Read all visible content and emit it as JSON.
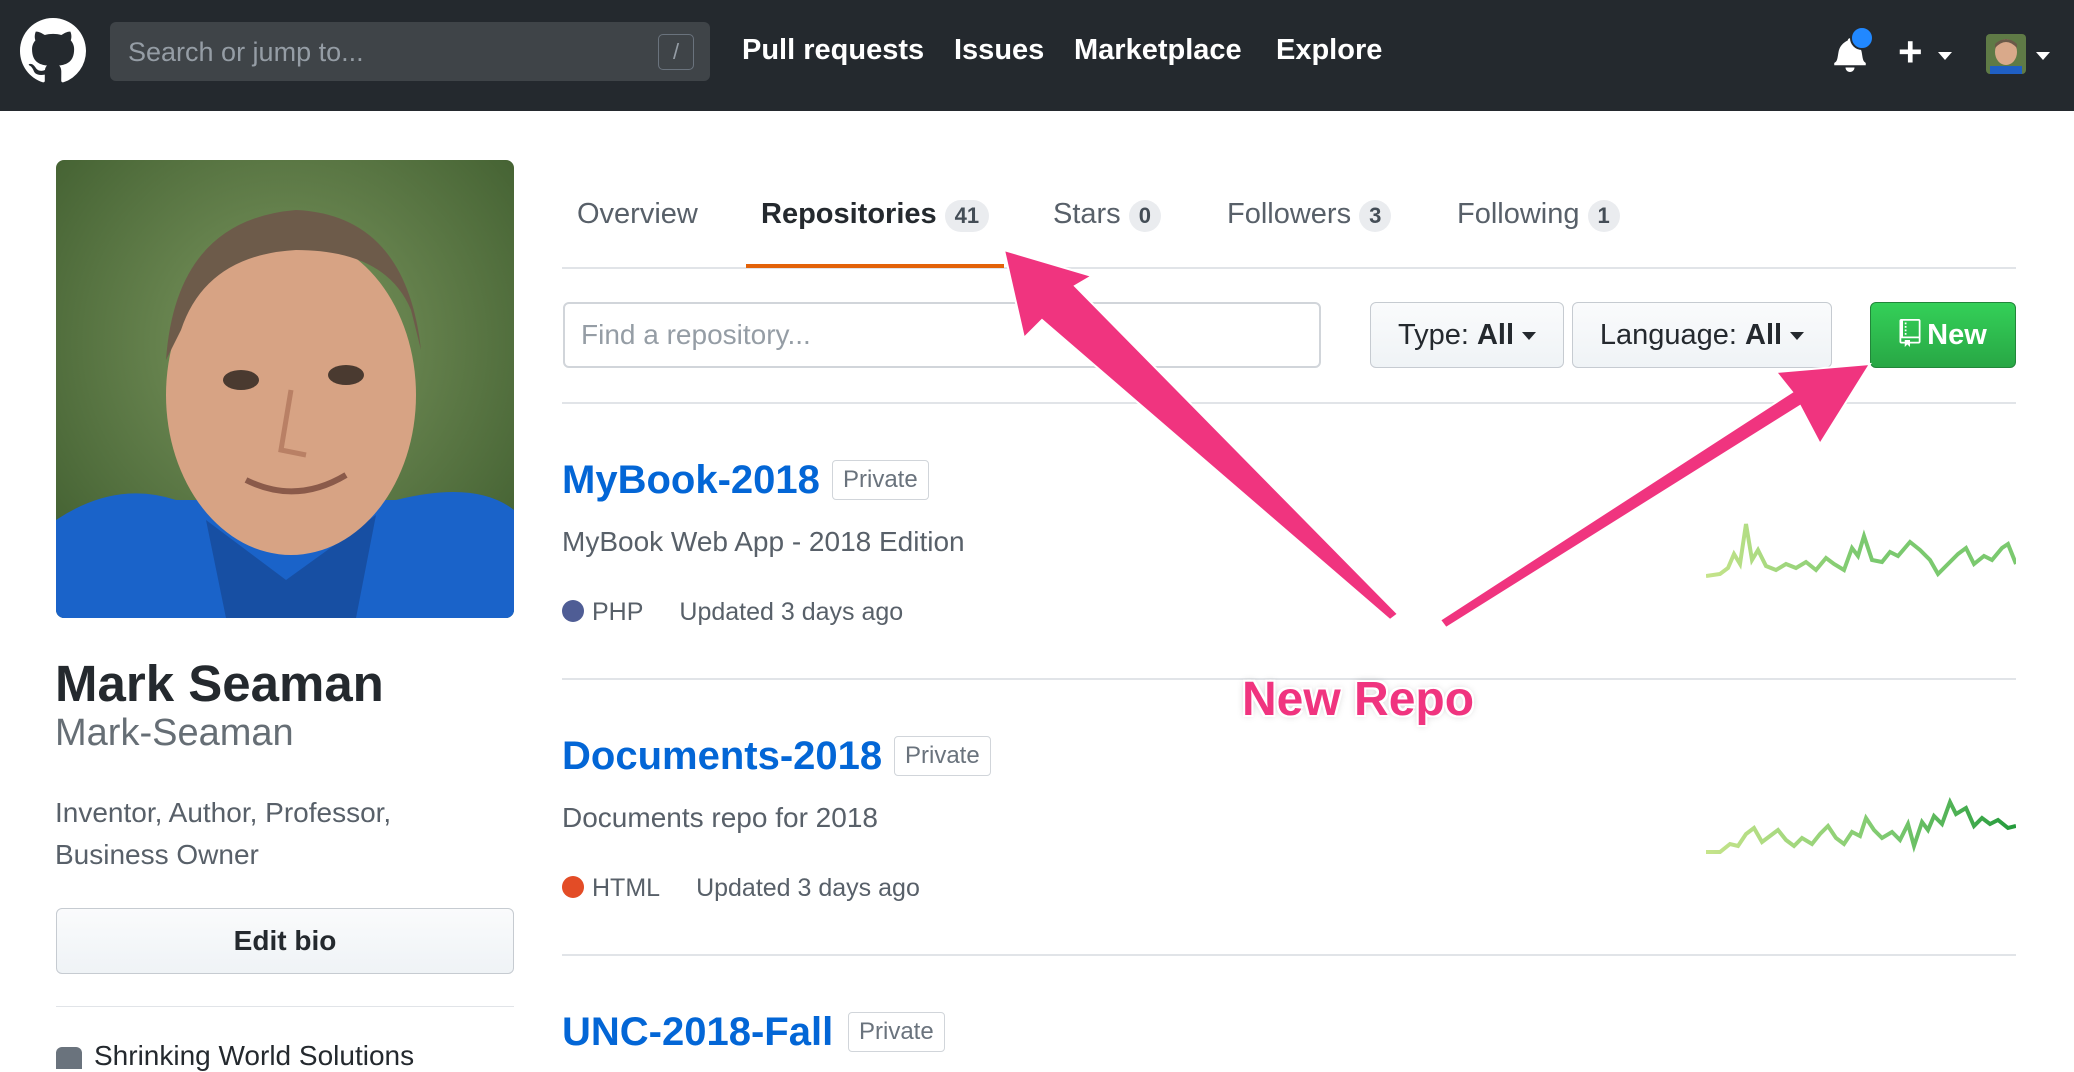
{
  "header": {
    "search_placeholder": "Search or jump to...",
    "search_shortcut": "/",
    "nav": [
      "Pull requests",
      "Issues",
      "Marketplace",
      "Explore"
    ]
  },
  "profile": {
    "name": "Mark Seaman",
    "login": "Mark-Seaman",
    "bio": "Inventor, Author, Professor, Business Owner",
    "edit_bio_label": "Edit bio",
    "org": "Shrinking World Solutions"
  },
  "tabs": [
    {
      "label": "Overview",
      "count": null
    },
    {
      "label": "Repositories",
      "count": "41"
    },
    {
      "label": "Stars",
      "count": "0"
    },
    {
      "label": "Followers",
      "count": "3"
    },
    {
      "label": "Following",
      "count": "1"
    }
  ],
  "filters": {
    "find_placeholder": "Find a repository...",
    "type_label": "Type:",
    "type_value": "All",
    "language_label": "Language:",
    "language_value": "All",
    "new_label": "New"
  },
  "repos": [
    {
      "name": "MyBook-2018",
      "visibility": "Private",
      "description": "MyBook Web App - 2018 Edition",
      "language": "PHP",
      "language_color": "#4F5D95",
      "updated": "Updated 3 days ago"
    },
    {
      "name": "Documents-2018",
      "visibility": "Private",
      "description": "Documents repo for 2018",
      "language": "HTML",
      "language_color": "#e34c26",
      "updated": "Updated 3 days ago"
    },
    {
      "name": "UNC-2018-Fall",
      "visibility": "Private"
    }
  ],
  "annotation": {
    "text": "New Repo",
    "color": "#f0347f"
  },
  "colors": {
    "header_bg": "#24292e",
    "link": "#0366d6",
    "accent_tab": "#e36209",
    "new_button": "#28a745"
  },
  "icons": [
    "github-logo-icon",
    "bell-icon",
    "plus-icon",
    "repo-book-icon",
    "organization-icon"
  ]
}
